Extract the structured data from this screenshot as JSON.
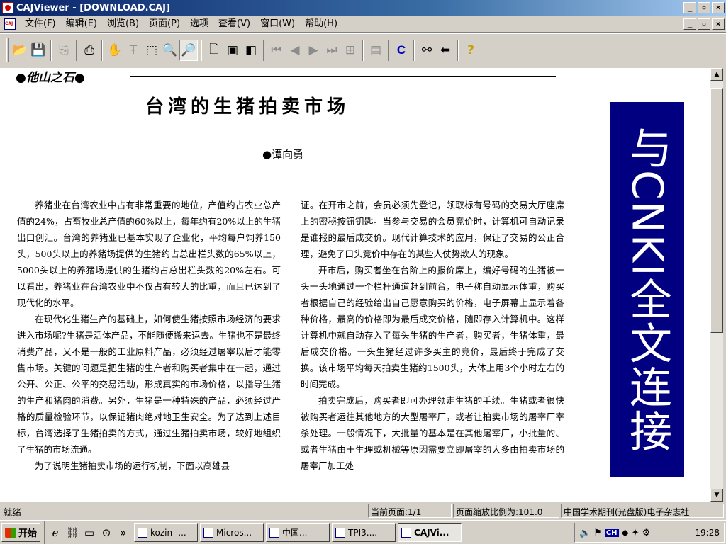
{
  "window": {
    "title": "CAJViewer - [DOWNLOAD.CAJ]",
    "min": "_",
    "max": "▫",
    "close": "×"
  },
  "menu": {
    "items": [
      "文件(F)",
      "编辑(E)",
      "浏览(B)",
      "页面(P)",
      "选项",
      "查看(V)",
      "窗口(W)",
      "帮助(H)"
    ]
  },
  "toolbar": {
    "c_label": "C",
    "help_label": "?"
  },
  "article": {
    "column_header": "●他山之石●",
    "title": "台湾的生猪拍卖市场",
    "author": "●谭向勇",
    "left_paragraphs": [
      "养猪业在台湾农业中占有非常重要的地位，产值约占农业总产值的24%，占畜牧业总产值的60%以上，每年约有20%以上的生猪出口创汇。台湾的养猪业已基本实现了企业化，平均每户饲养150头，500头以上的养猪场提供的生猪约占总出栏头数的65%以上，5000头以上的养猪场提供的生猪约占总出栏头数的20%左右。可以看出，养猪业在台湾农业中不仅占有较大的比重，而且已达到了现代化的水平。",
      "在现代化生猪生产的基础上，如何使生猪按照市场经济的要求进入市场呢?生猪是活体产品，不能随便搬来运去。生猪也不是最终消费产品，又不是一般的工业原料产品，必须经过屠宰以后才能零售市场。关键的问题是把生猪的生产者和购买者集中在一起，通过公开、公正、公平的交易活动，形成真实的市场价格，以指导生猪的生产和猪肉的消费。另外，生猪是一种特殊的产品，必须经过严格的质量检验环节，以保证猪肉绝对地卫生安全。为了达到上述目标，台湾选择了生猪拍卖的方式，通过生猪拍卖市场，较好地组织了生猪的市场流通。",
      "为了说明生猪拍卖市场的运行机制，下面以高雄县"
    ],
    "right_paragraphs": [
      "证。在开市之前，会员必须先登记，领取标有号码的交易大厅座席上的密秘按钮钥匙。当参与交易的会员竞价时，计算机可自动记录是谁报的最后成交价。现代计算技术的应用，保证了交易的公正合理，避免了口头竞价中存在的某些人仗势欺人的现象。",
      "开市后，购买者坐在台阶上的报价席上，编好号码的生猪被一头一头地通过一个栏杆通道赶到前台，电子称自动显示体重，购买者根据自己的经验给出自己愿意购买的价格，电子屏幕上显示着各种价格，最高的价格即为最后成交价格，随即存入计算机中。这样计算机中就自动存入了每头生猪的生产者，购买者，生猪体重，最后成交价格。一头生猪经过许多买主的竞价，最后终于完成了交换。该市场平均每天拍卖生猪约1500头，大体上用3个小时左右的时间完成。",
      "拍卖完成后，购买者即可办理领走生猪的手续。生猪或者很快被购买者运往其他地方的大型屠宰厂，或者让拍卖市场的屠宰厂宰杀处理。一般情况下，大批量的基本是在其他屠宰厂，小批量的、或者生猪由于生理或机械等原因需要立即屠宰的大多由拍卖市场的屠宰厂加工处"
    ],
    "banner_text": "与CNKI全文连接"
  },
  "statusbar": {
    "ready": "就绪",
    "page": "当前页面:1/1",
    "zoom": "页面缩放比例为:101.0",
    "source": "中国学术期刊(光盘版)电子杂志社"
  },
  "taskbar": {
    "start_label": "开始",
    "more": "»",
    "tasks": [
      "kozin -...",
      "Micros...",
      "中国...",
      "TPI3....",
      "CAJVi..."
    ],
    "ime": "CH",
    "clock": "19:28"
  }
}
